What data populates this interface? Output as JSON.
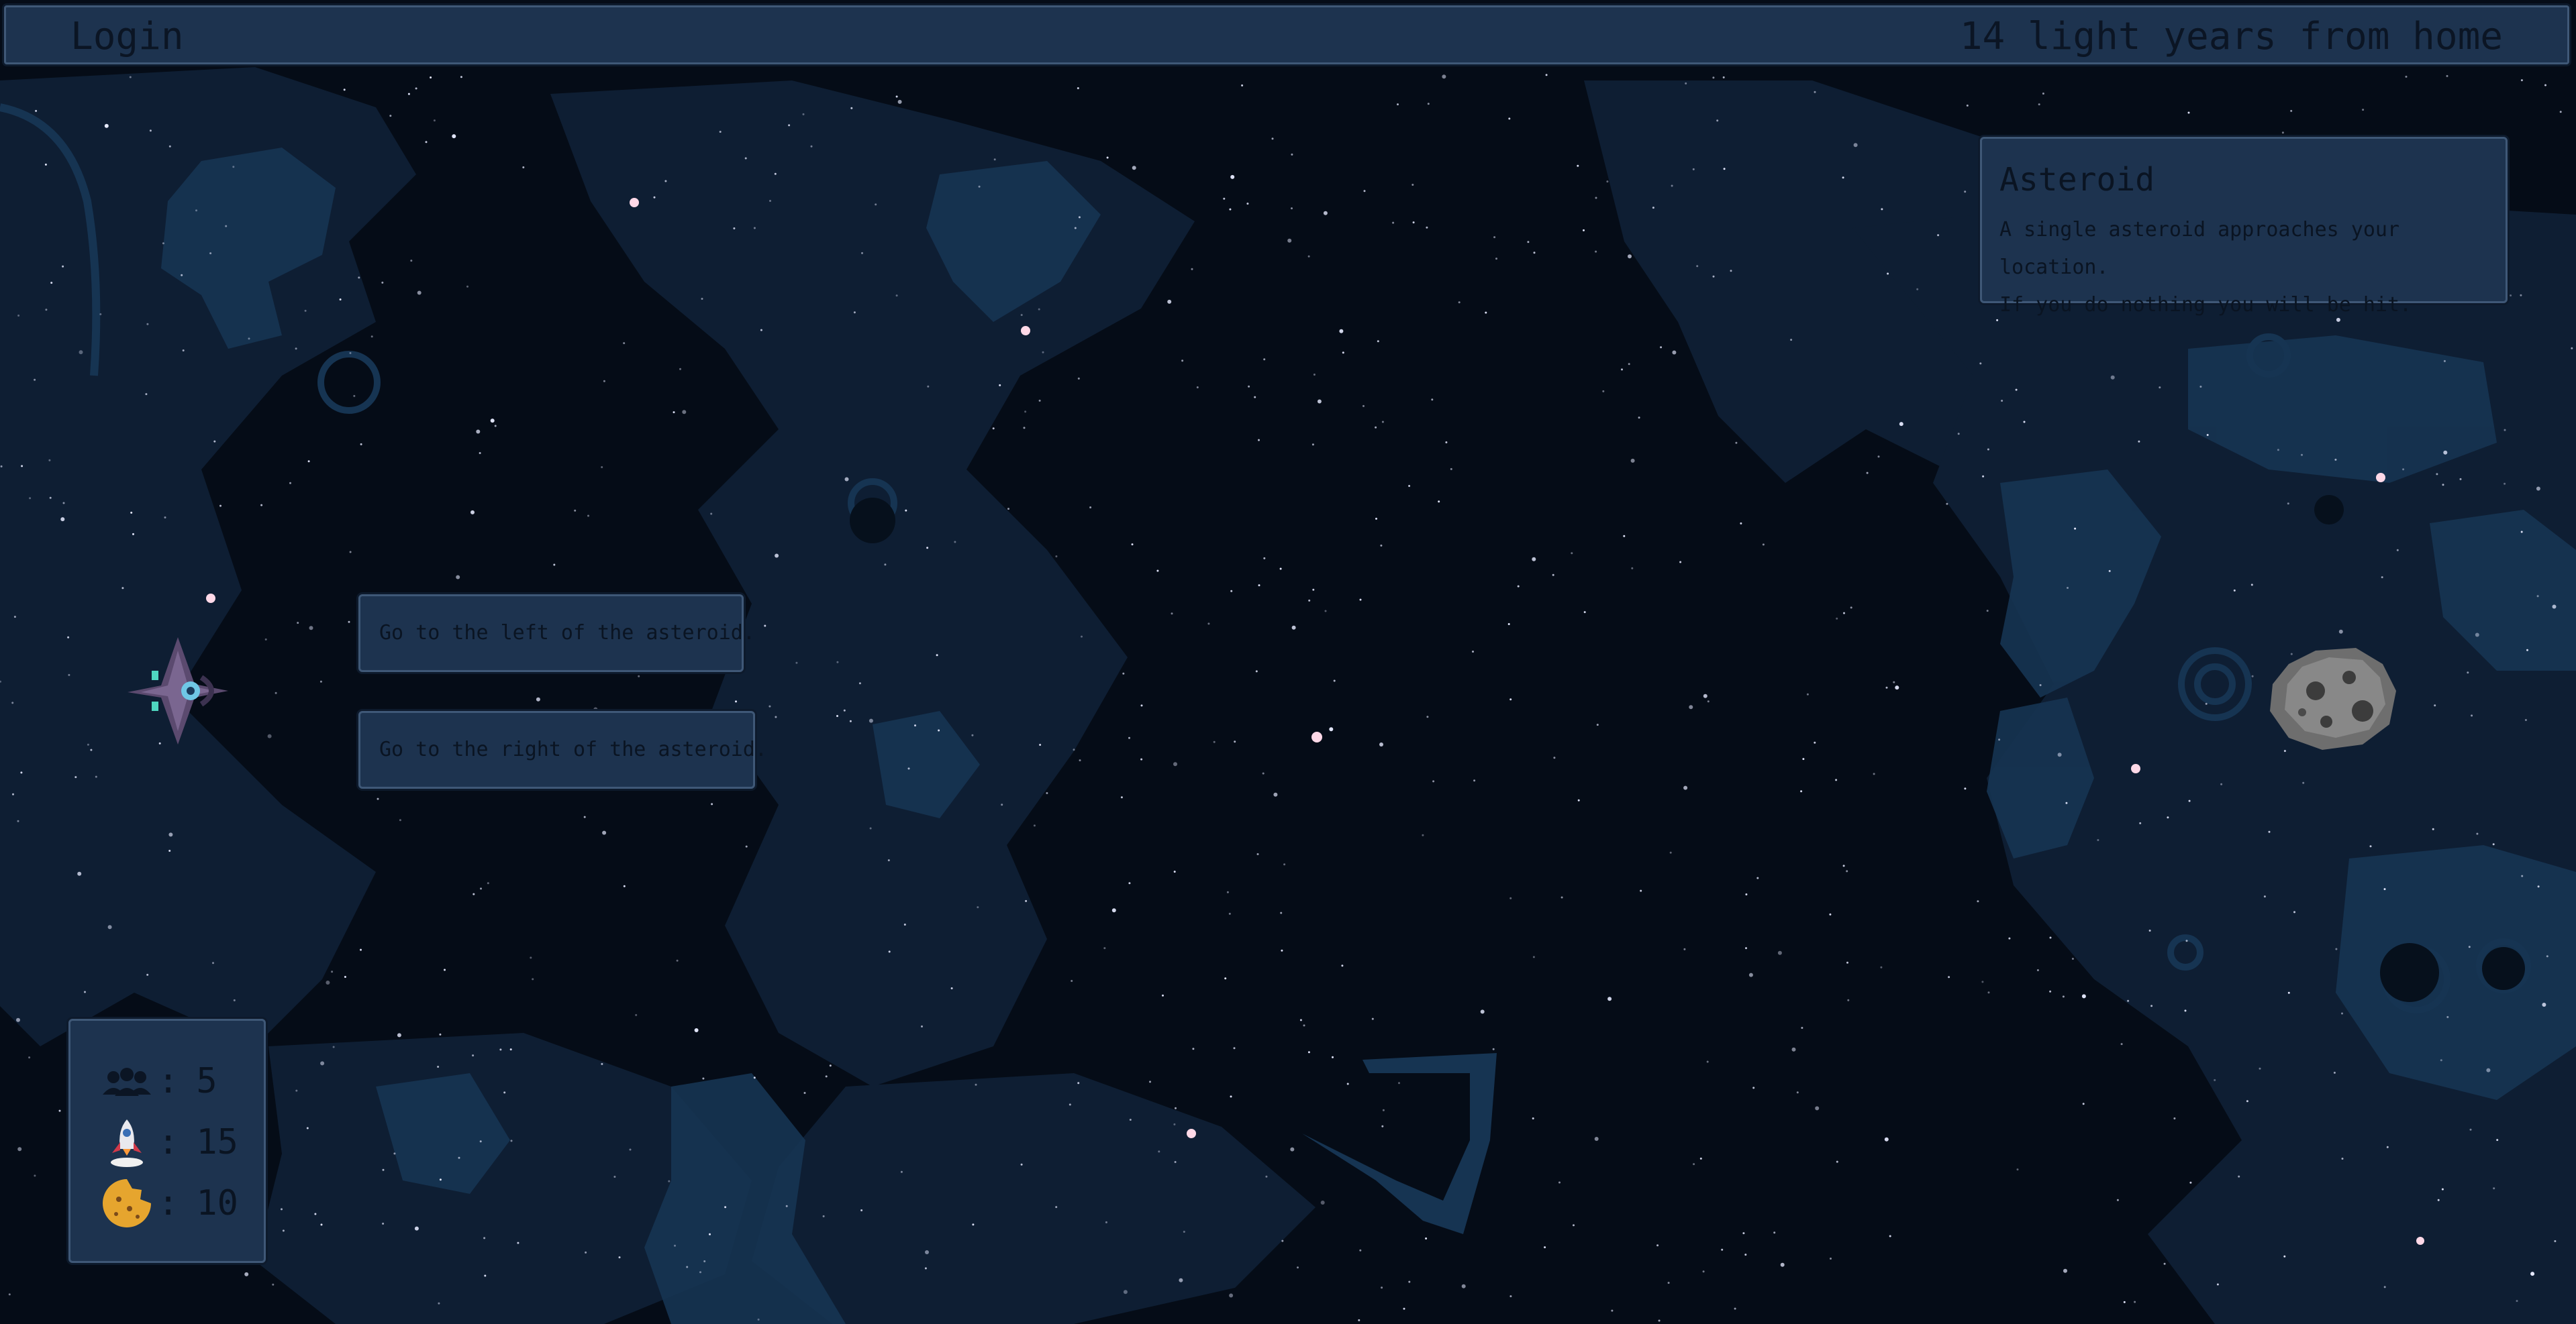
{
  "header": {
    "login_label": "Login",
    "distance_text": "14 light years from home"
  },
  "event": {
    "title": "Asteroid",
    "lines": [
      "A single asteroid approaches your location.",
      "If you do nothing you will be hit."
    ]
  },
  "choices": [
    "Go to the left of the asteroid.",
    "Go to the right of the asteroid."
  ],
  "stats": {
    "separator": ":",
    "crew": {
      "icon": "crew-icon",
      "value": "5"
    },
    "fuel": {
      "icon": "rocket-icon",
      "value": "15"
    },
    "food": {
      "icon": "cookie-icon",
      "value": "10"
    }
  },
  "colors": {
    "background": "#050c17",
    "panel": "#1d334f",
    "panel_border": "#3f5877",
    "text": "#0b1524",
    "nebula": "#163452"
  },
  "sprites": {
    "ship": "spaceship-sprite",
    "asteroid": "asteroid-sprite"
  }
}
